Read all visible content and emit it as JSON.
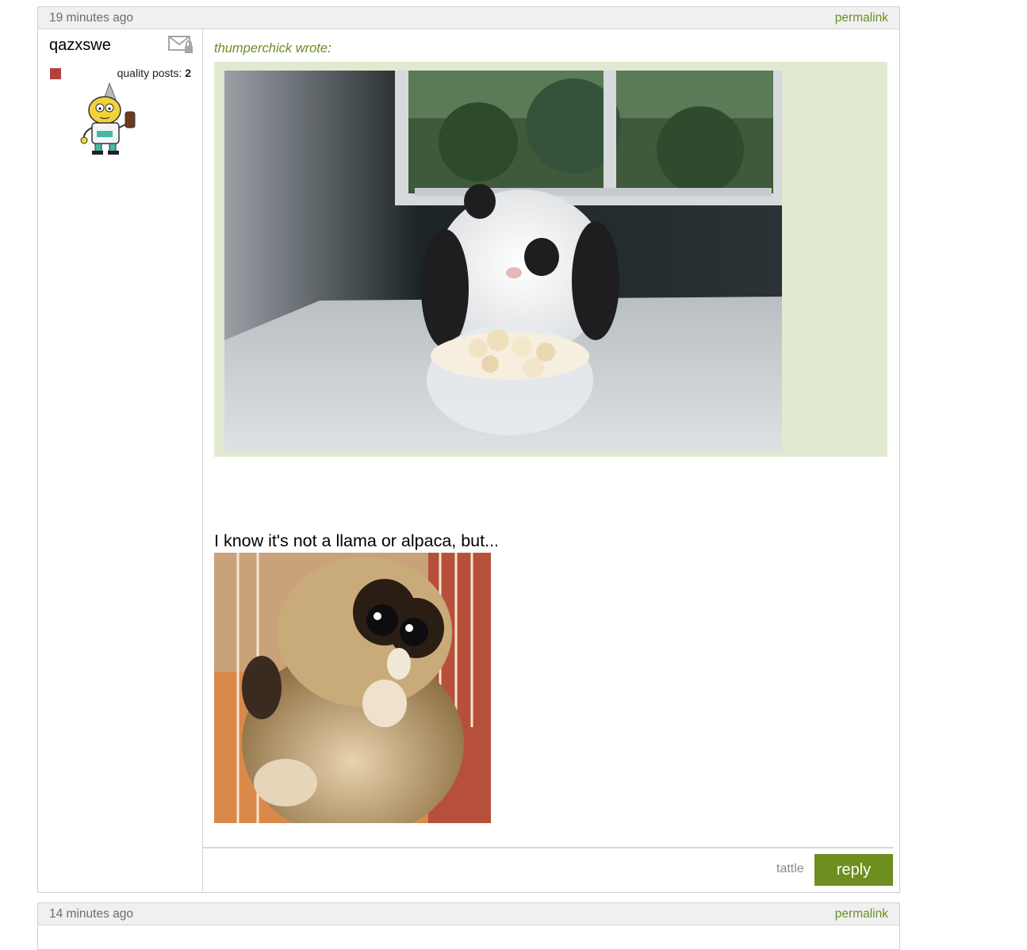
{
  "posts": [
    {
      "timestamp": "19 minutes ago",
      "permalink": "permalink",
      "author": "qazxswe",
      "quality_label": "quality posts:",
      "quality_count": "2",
      "quote": {
        "author": "thumperchick",
        "wrote": "wrote",
        "colon": ":",
        "image": "bunny eating popcorn"
      },
      "text": "I know it's not a llama or alpaca, but...",
      "image": "slow loris eating",
      "actions": {
        "tattle": "tattle",
        "reply": "reply"
      }
    },
    {
      "timestamp": "14 minutes ago",
      "permalink": "permalink"
    }
  ],
  "icons": {
    "mail": "mail-lock-icon",
    "badge": "quality-badge-icon"
  },
  "colors": {
    "accent": "#6b8e23",
    "reply_button": "#6e8e1f",
    "quote_bg": "#e1ead1",
    "badge": "#b2423f",
    "header_bg": "#f0f0f0"
  }
}
